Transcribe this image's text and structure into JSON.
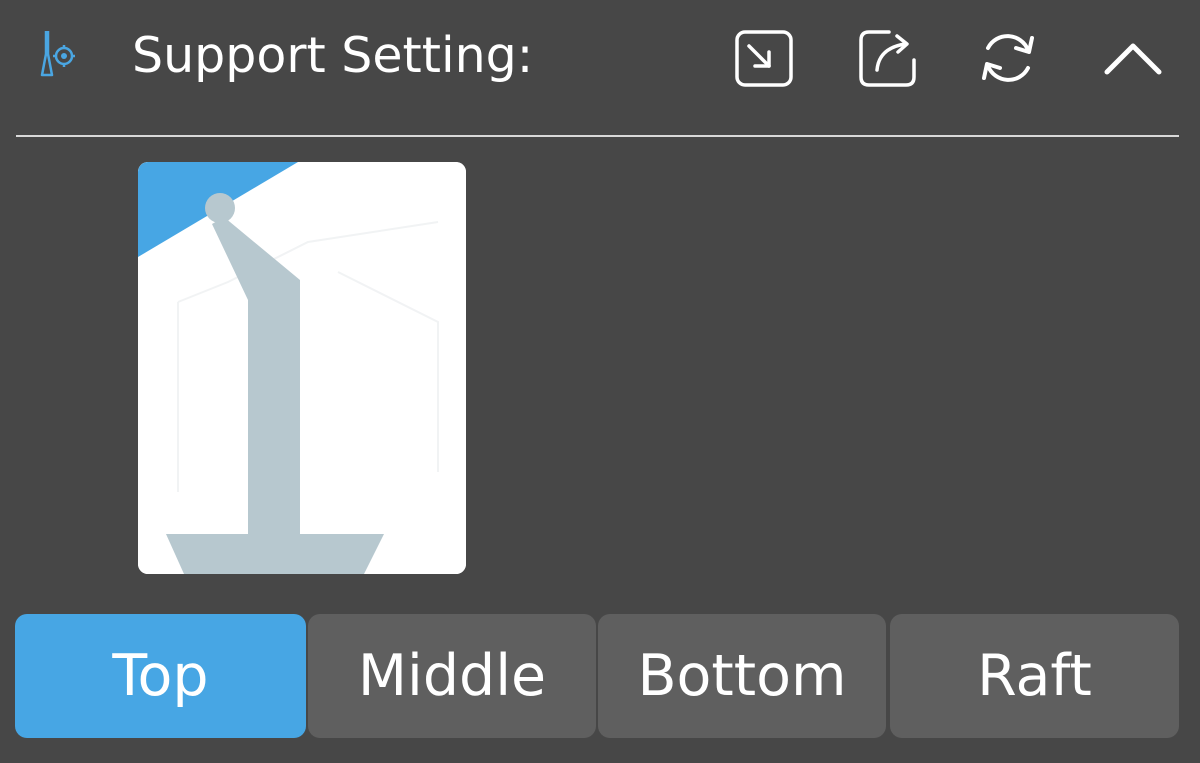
{
  "header": {
    "title": "Support Setting:",
    "icon": "support-setting-icon",
    "actions": [
      {
        "name": "import-icon"
      },
      {
        "name": "export-icon"
      },
      {
        "name": "reset-icon"
      },
      {
        "name": "collapse-chevron-up-icon"
      }
    ]
  },
  "preview": {
    "image": "support-top-preview",
    "highlight_color": "#47a6e4",
    "support_color": "#b7c8cf"
  },
  "tabs": [
    {
      "label": "Top",
      "selected": true
    },
    {
      "label": "Middle",
      "selected": false
    },
    {
      "label": "Bottom",
      "selected": false
    },
    {
      "label": "Raft",
      "selected": false
    }
  ],
  "colors": {
    "background": "#474747",
    "tab": "#5f5f5f",
    "tab_active": "#47a6e4",
    "text": "#ffffff"
  }
}
